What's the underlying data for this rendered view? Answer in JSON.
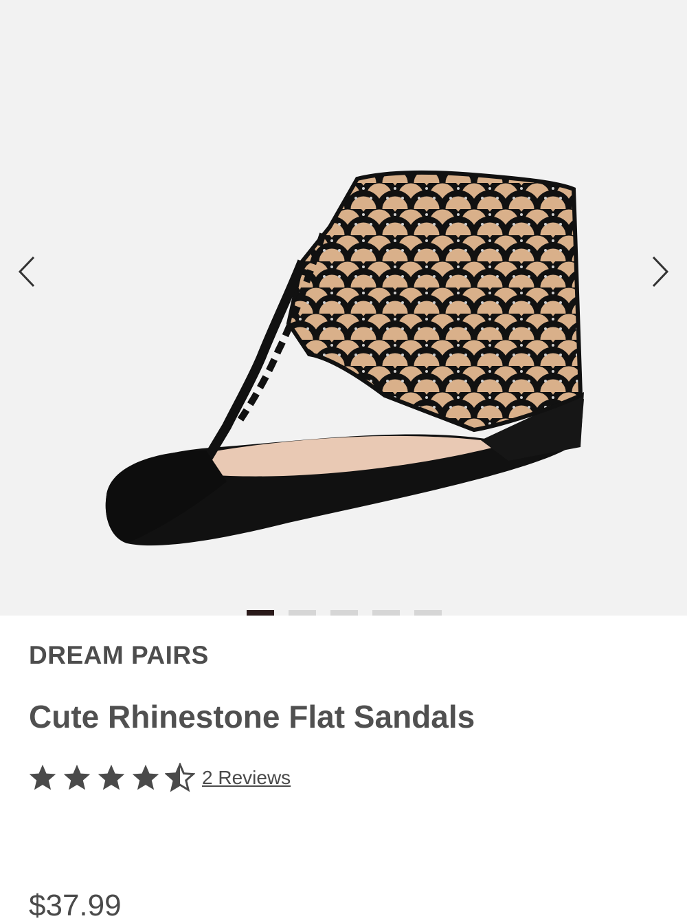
{
  "gallery": {
    "image_alt": "Black caged rhinestone thong flat sandal",
    "prev_icon": "chevron-left-icon",
    "next_icon": "chevron-right-icon",
    "slide_count": 5,
    "active_slide": 1
  },
  "product": {
    "brand": "DREAM PAIRS",
    "title": "Cute Rhinestone Flat Sandals",
    "rating": 4.5,
    "rating_max": 5,
    "reviews_label": "2 Reviews",
    "price": "$37.99"
  },
  "colors": {
    "gallery_bg": "#f2f2f2",
    "star": "#4a4a4a",
    "active_dot": "#2a1a1a",
    "inactive_dot": "#d6d6d6"
  }
}
